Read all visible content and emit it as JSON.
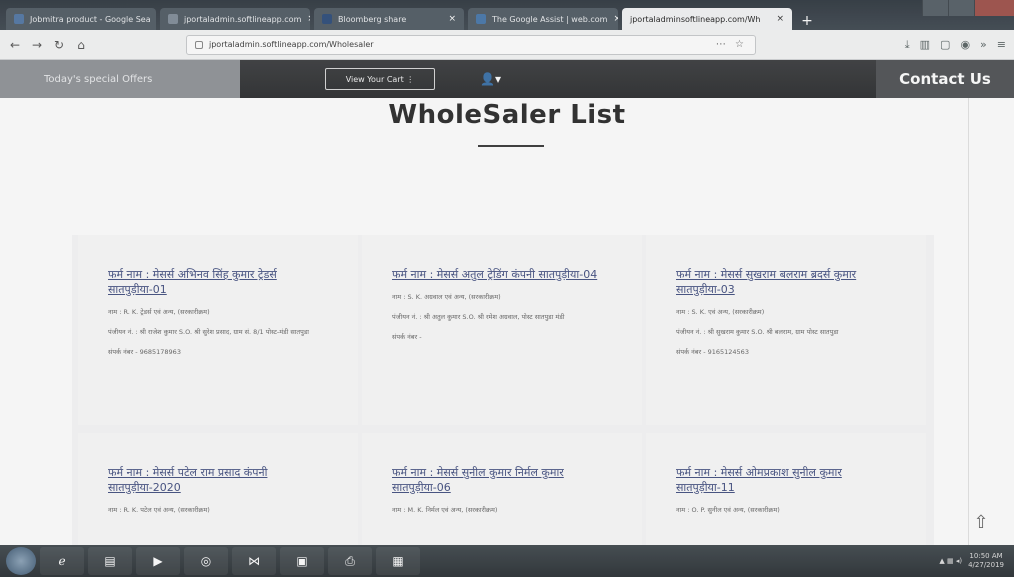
{
  "browser": {
    "tabs": [
      {
        "label": "Jobmitra product - Google Sea",
        "active": false
      },
      {
        "label": "jportaladmin.softlineapp.com",
        "active": false
      },
      {
        "label": "Bloomberg share",
        "active": false
      },
      {
        "label": "The Google Assist | web.com",
        "active": false
      },
      {
        "label": "jportaladminsoftlineapp.com/Wh",
        "active": true
      }
    ],
    "url": "jportaladmin.softlineapp.com/Wholesaler",
    "new_tab": "+"
  },
  "site": {
    "offers_label": "Today's special Offers",
    "cart_label": "View Your Cart ⋮",
    "contact_label": "Contact Us",
    "page_title": "WholeSaler List"
  },
  "cards": [
    {
      "title": "फर्म नाम : मेसर्स अभिनव सिंह कुमार ट्रेडर्स सातपुड़ीया-01",
      "line1": "नाम : R. K. ट्रेडर्स एवं अन्य, (सरकारीक्रम)",
      "line2": "पंजीयन नं. : श्री राजेश कुमार S.O. श्री सुरेश प्रसाद, ग्राम सं. 8/1 पोस्ट-मंडी सातपुडा",
      "line3": "संपर्क नंबर - 9685178963"
    },
    {
      "title": "फर्म नाम : मेसर्स अतुल ट्रेडिंग कंपनी सातपुड़ीया-04",
      "line1": "नाम : S. K. अग्रवाल एवं अन्य, (सरकारीक्रम)",
      "line2": "पंजीयन नं. : श्री अतुल कुमार S.O. श्री रमेश अग्रवाल, पोस्ट सातपुडा मंडी",
      "line3": "संपर्क नंबर -"
    },
    {
      "title": "फर्म नाम : मेसर्स सुखराम बलराम ब्रदर्स कुमार सातपुड़ीया-03",
      "line1": "नाम : S. K. एवं अन्य, (सरकारीक्रम)",
      "line2": "पंजीयन नं. : श्री सुखराम कुमार S.O. श्री बलराम, ग्राम पोस्ट सातपुडा",
      "line3": "संपर्क नंबर - 9165124563"
    },
    {
      "title": "फर्म नाम : मेसर्स पटेल राम प्रसाद कंपनी सातपुड़ीया-2020",
      "line1": "नाम : R. K. पटेल एवं अन्य, (सरकारीक्रम)",
      "line2": "",
      "line3": ""
    },
    {
      "title": "फर्म नाम : मेसर्स सुनील कुमार निर्मल कुमार सातपुड़ीया-06",
      "line1": "नाम : M. K. निर्मल एवं अन्य, (सरकारीक्रम)",
      "line2": "",
      "line3": ""
    },
    {
      "title": "फर्म नाम : मेसर्स ओमप्रकाश सुनील कुमार सातपुड़ीया-11",
      "line1": "नाम : O. P. सुनील एवं अन्य, (सरकारीक्रम)",
      "line2": "",
      "line3": ""
    }
  ],
  "taskbar": {
    "time": "10:50 AM",
    "date": "4/27/2019"
  }
}
